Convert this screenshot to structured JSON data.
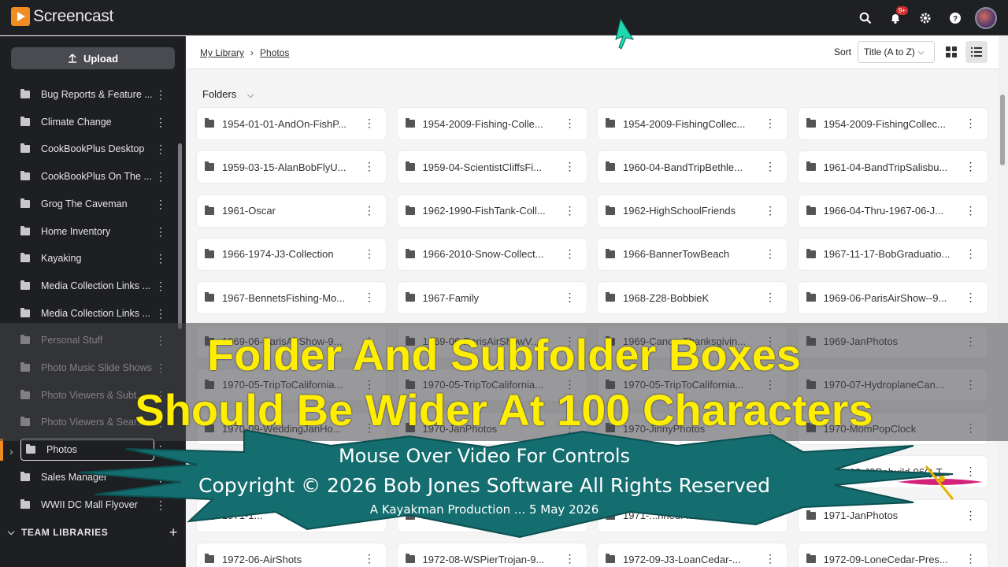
{
  "app": {
    "name": "Screencast"
  },
  "topbar": {
    "notif_badge": "9+"
  },
  "sidebar": {
    "upload_label": "Upload",
    "items": [
      {
        "label": "Bug Reports & Feature ..."
      },
      {
        "label": "Climate Change"
      },
      {
        "label": "CookBookPlus Desktop"
      },
      {
        "label": "CookBookPlus On The ..."
      },
      {
        "label": "Grog The Caveman"
      },
      {
        "label": "Home Inventory"
      },
      {
        "label": "Kayaking"
      },
      {
        "label": "Media Collection Links ..."
      },
      {
        "label": "Media Collection Links ..."
      },
      {
        "label": "Personal Stuff"
      },
      {
        "label": "Photo Music Slide Shows"
      },
      {
        "label": "Photo Viewers & Subt..."
      },
      {
        "label": "Photo Viewers & Sear..."
      },
      {
        "label": "Photos"
      },
      {
        "label": "Sales Manager"
      },
      {
        "label": "WWII DC Mall Flyover"
      }
    ],
    "team_libraries": "TEAM LIBRARIES"
  },
  "breadcrumb": {
    "root": "My Library",
    "current": "Photos"
  },
  "sort": {
    "label": "Sort",
    "value": "Title (A to Z)"
  },
  "folders_heading": "Folders",
  "folders": [
    "1954-01-01-AndOn-FishP...",
    "1954-2009-Fishing-Colle...",
    "1954-2009-FishingCollec...",
    "1954-2009-FishingCollec...",
    "1959-03-15-AlanBobFlyU...",
    "1959-04-ScientistCliffsFi...",
    "1960-04-BandTripBethle...",
    "1961-04-BandTripSalisbu...",
    "1961-Oscar",
    "1962-1990-FishTank-Coll...",
    "1962-HighSchoolFriends",
    "1966-04-Thru-1967-06-J...",
    "1966-1974-J3-Collection",
    "1966-2010-Snow-Collect...",
    "1966-BannerTowBeach",
    "1967-11-17-BobGraduatio...",
    "1967-BennetsFishing-Mo...",
    "1967-Family",
    "1968-Z28-BobbieK",
    "1969-06-ParisAirShow--9...",
    "1969-06-ParisAirShow-9...",
    "1969-06-ParisAirShowV...",
    "1969-Canoe-Thanksgivin...",
    "1969-JanPhotos",
    "1970-05-TripToCalifornia...",
    "1970-05-TripToCalifornia...",
    "1970-05-TripToCalifornia...",
    "1970-07-HydroplaneCan...",
    "1970-09-WeddingJanHo...",
    "1970-JanPhotos",
    "1970-JinnyPhotos",
    "1970-MomPopClock",
    "1971-...",
    "1971-...",
    "1971-...",
    "1971-10-J3Rebuild-96Q-T...",
    "1971-1...",
    "1971-...",
    "1971-...nnedP...",
    "1971-JanPhotos",
    "1972-06-AirShots",
    "1972-08-WSPierTrojan-9...",
    "1972-09-J3-LoanCedar-...",
    "1972-09-LoneCedar-Pres..."
  ],
  "overlay": {
    "caption_line1": "Folder And Subfolder Boxes",
    "caption_line2": "Should Be Wider At 100 Characters",
    "burst_line1": "Mouse Over Video For Controls",
    "burst_line2": "Copyright © 2026 Bob Jones Software All Rights Reserved",
    "burst_line3": "A Kayakman Production ... 5 May 2026"
  },
  "colors": {
    "accent": "#f18c22",
    "caption": "#ffee00",
    "burst": "#146d6f",
    "topbar": "#1f2023",
    "sidebar": "#1e1f22"
  }
}
